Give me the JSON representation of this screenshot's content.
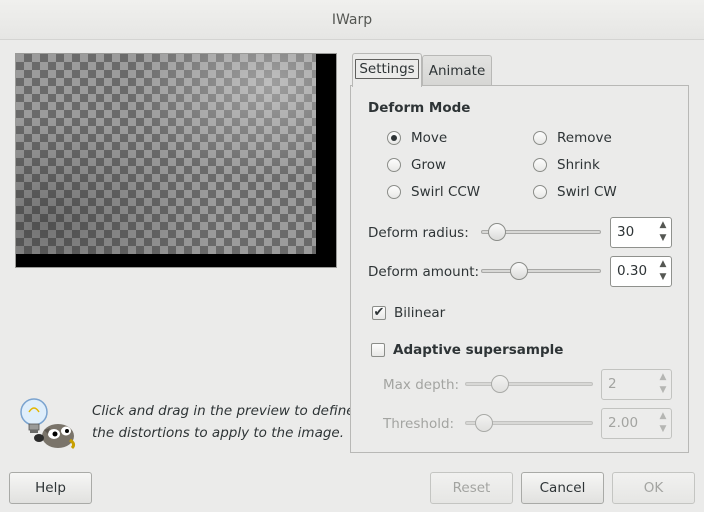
{
  "window": {
    "title": "IWarp"
  },
  "hint": {
    "line1": "Click and drag in the preview to define",
    "line2": "the distortions to apply to the image."
  },
  "tabs": [
    {
      "label": "Settings",
      "active": true
    },
    {
      "label": "Animate",
      "active": false
    }
  ],
  "settings": {
    "deform_mode": {
      "title": "Deform Mode",
      "selected": "Move",
      "options": [
        "Move",
        "Remove",
        "Grow",
        "Shrink",
        "Swirl CCW",
        "Swirl CW"
      ]
    },
    "deform_radius": {
      "label": "Deform radius:",
      "value": "30"
    },
    "deform_amount": {
      "label": "Deform amount:",
      "value": "0.30"
    },
    "bilinear": {
      "label": "Bilinear",
      "checked": true,
      "mark": "✔"
    },
    "adaptive": {
      "label": "Adaptive supersample",
      "checked": false
    },
    "max_depth": {
      "label": "Max depth:",
      "value": "2"
    },
    "threshold": {
      "label": "Threshold:",
      "value": "2.00"
    }
  },
  "buttons": {
    "help": "Help",
    "reset": "Reset",
    "cancel": "Cancel",
    "ok": "OK"
  }
}
